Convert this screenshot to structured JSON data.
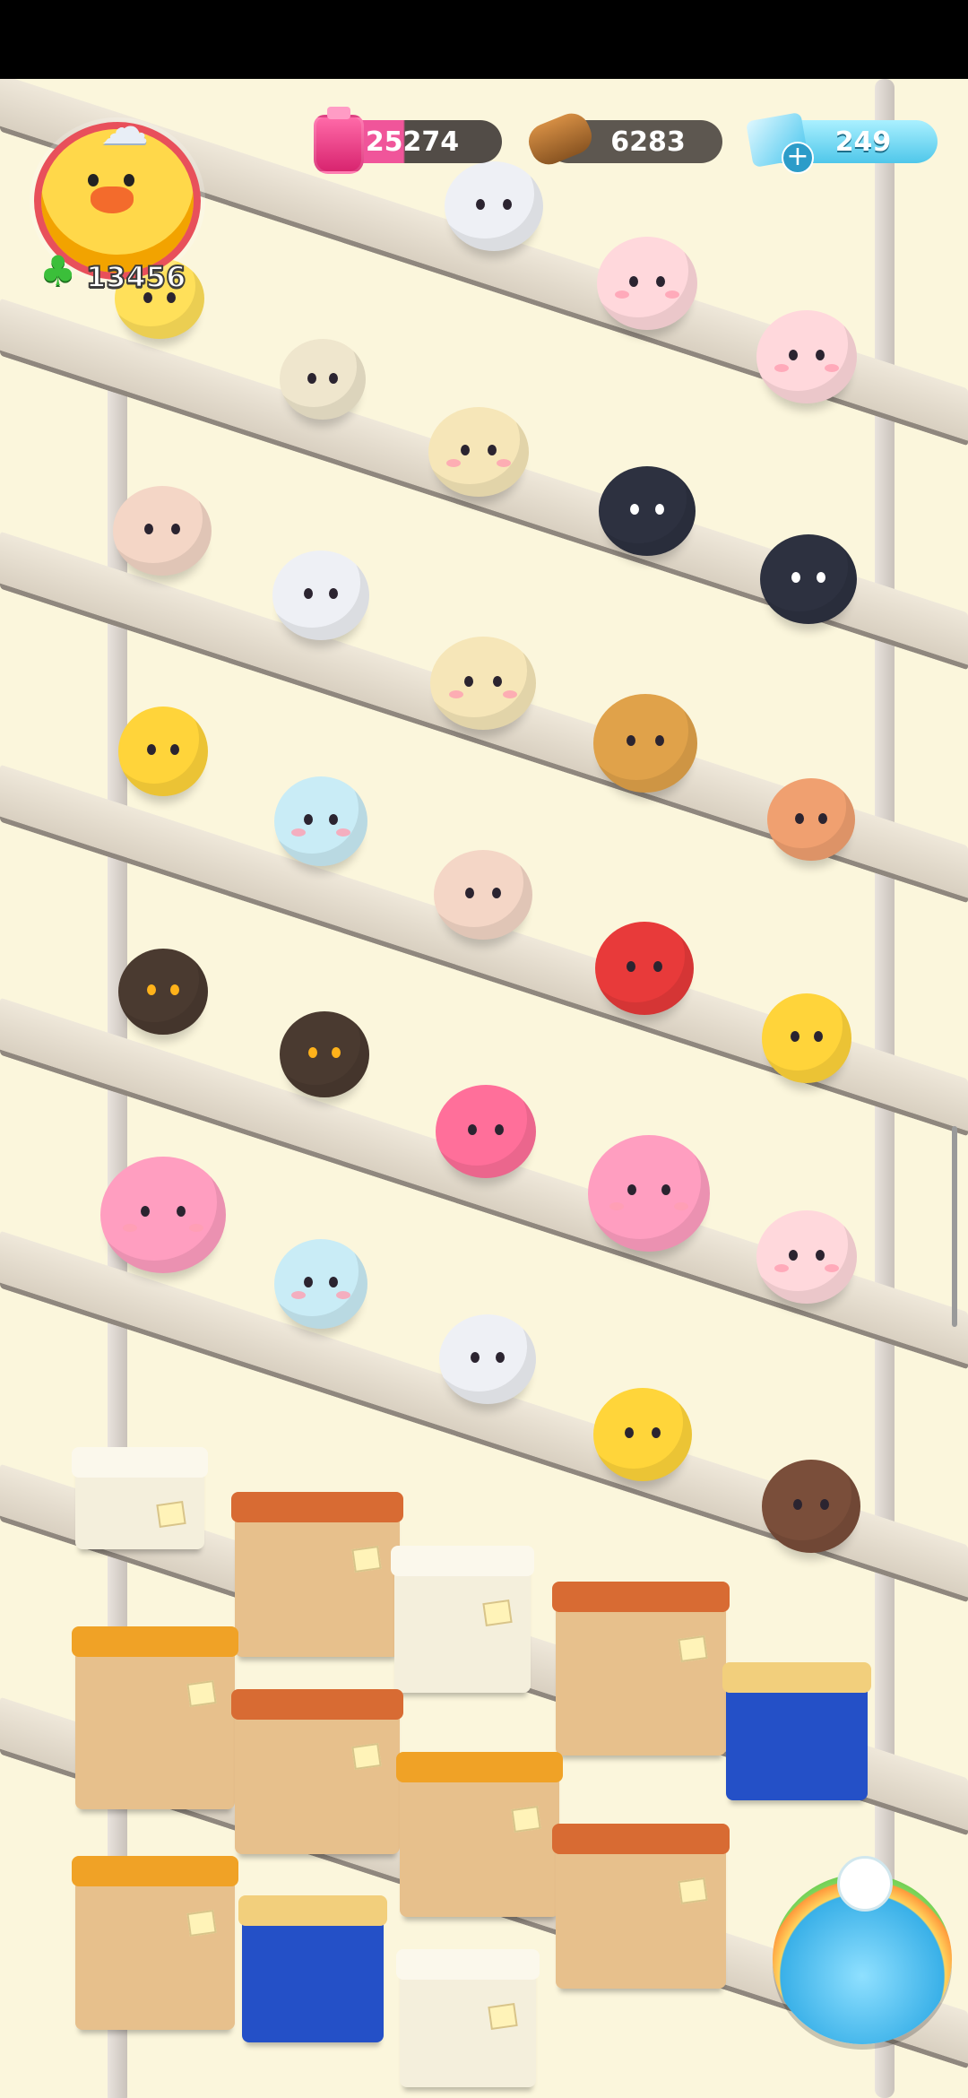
{
  "hud": {
    "clover_count": "13456",
    "ink_count": "25274",
    "wood_count": "6283",
    "gem_count": "249",
    "plus_symbol": "+"
  },
  "icons": {
    "avatar": "duck-avatar-icon",
    "weather": "cloud-icon",
    "clover": "clover-icon",
    "ink": "ink-bottle-icon",
    "wood": "wood-log-icon",
    "gem": "gem-icon",
    "add": "plus-icon",
    "fountain": "fountain-icon"
  },
  "colors": {
    "background": "#fbf6dc",
    "shelf": "#e6dfd1",
    "pill": "#282222",
    "gem_pill": "#6fd9f2",
    "ink_pill": "#f0559a",
    "clover": "#3bbf3a"
  },
  "critters": [
    {
      "kind": "panda-bear",
      "color": "#f2e6c8"
    },
    {
      "kind": "husky",
      "color": "#eef0f5"
    },
    {
      "kind": "monkey",
      "color": "#f4d6c6"
    },
    {
      "kind": "cow",
      "color": "#f6e6b8"
    },
    {
      "kind": "skunk",
      "color": "#2d3140"
    },
    {
      "kind": "penguin",
      "color": "#ffd43a"
    },
    {
      "kind": "bird",
      "color": "#c9ecf6"
    },
    {
      "kind": "shiba",
      "color": "#e0a24a"
    },
    {
      "kind": "hamster",
      "color": "#f0a070"
    },
    {
      "kind": "crow",
      "color": "#4a3a30"
    },
    {
      "kind": "fox",
      "color": "#ff6f9a"
    },
    {
      "kind": "alpaca",
      "color": "#ff9ec0"
    },
    {
      "kind": "mouse-red",
      "color": "#e83a3a"
    },
    {
      "kind": "tiger",
      "color": "#ffd53a"
    },
    {
      "kind": "brown-bear",
      "color": "#7a4e3a"
    },
    {
      "kind": "sheep-pink",
      "color": "#ffd8dc"
    }
  ]
}
